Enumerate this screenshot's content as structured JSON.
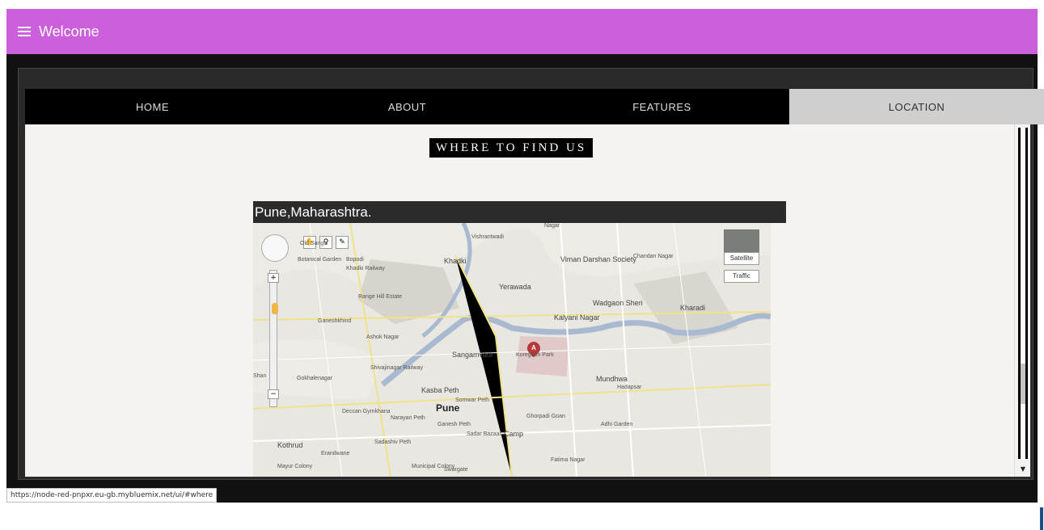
{
  "header": {
    "title": "Welcome",
    "menu_icon": "hamburger-icon"
  },
  "tabs": [
    {
      "label": "HOME",
      "active": false
    },
    {
      "label": "ABOUT",
      "active": false
    },
    {
      "label": "FEATURES",
      "active": false
    },
    {
      "label": "LOCATION",
      "active": true
    }
  ],
  "section": {
    "title": "WHERE TO FIND US"
  },
  "map": {
    "header": "Pune,Maharashtra.",
    "controls": {
      "satellite_label": "Satellite",
      "traffic_label": "Traffic"
    },
    "marker_label": "A",
    "places": [
      "Nagar",
      "Vishrantwadi",
      "Old Sangvi",
      "Botanical Garden",
      "Bopodi",
      "Khadki Railway",
      "Khadki",
      "Viman Darshan Society",
      "Chandan Nagar",
      "Range Hill Estate",
      "Yerawada",
      "Wadgaon Sheri",
      "Kharadi",
      "Ganeshkhind",
      "Kalyani Nagar",
      "Ashok Nagar",
      "Sangamvadi",
      "Koregaon Park",
      "Shivajinagar Railway",
      "Mundhwa",
      "Hadapsar",
      "Gokhalenagar",
      "Kasba Peth",
      "Somwar Peth",
      "Pune",
      "Deccan Gymkhana",
      "Narayan Peth",
      "Ganesh Peth",
      "Sadar Bazaar",
      "Camp",
      "Ghorpadi Goan",
      "Kothrud",
      "Erandwane",
      "Sadashiv Peth",
      "Swargate",
      "Mayur Colony",
      "Municipal Colony",
      "Adhi Garden",
      "Fatima Nagar",
      "Shan"
    ]
  },
  "status_url": "https://node-red-pnpxr.eu-gb.mybluemix.net/ui/#where",
  "colors": {
    "header_bg": "#cc5fdb",
    "tab_bar": "#000000",
    "active_tab": "#cfcfcf",
    "content_bg": "#f4f3f0"
  }
}
